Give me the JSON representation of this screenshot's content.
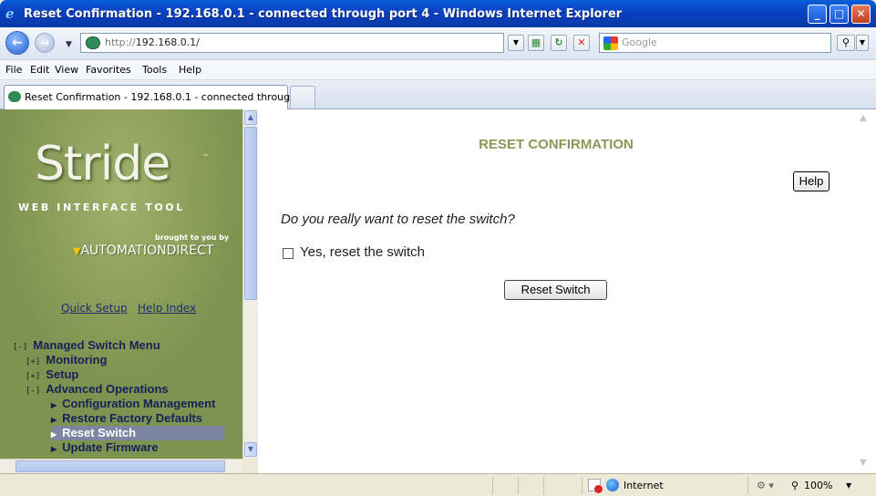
{
  "window": {
    "title": "Reset Confirmation - 192.168.0.1 - connected through port 4 - Windows Internet Explorer",
    "minimize": "_",
    "maximize": "□",
    "close": "✕"
  },
  "addressbar": {
    "url_prefix": "http://",
    "url_host": "192.168.0.1/",
    "search_placeholder": "Google"
  },
  "menubar": [
    "File",
    "Edit",
    "View",
    "Favorites",
    "Tools",
    "Help"
  ],
  "tab": {
    "label": "Reset Confirmation - 192.168.0.1 - connected throug..."
  },
  "sidebar": {
    "logo_word": "Stride",
    "logo_tm": "™",
    "tagline": "WEB INTERFACE TOOL",
    "brought_by": "brought to you by",
    "brand": "AUTOMATIONDIRECT",
    "links": {
      "quick_setup": "Quick Setup",
      "help_index": "Help Index"
    },
    "menu": {
      "root": {
        "toggle": "[-]",
        "label": "Managed Switch Menu"
      },
      "monitoring": {
        "toggle": "[+]",
        "label": "Monitoring"
      },
      "setup": {
        "toggle": "[+]",
        "label": "Setup"
      },
      "advanced": {
        "toggle": "[-]",
        "label": "Advanced Operations"
      },
      "items": [
        {
          "label": "Configuration Management",
          "selected": false
        },
        {
          "label": "Restore Factory Defaults",
          "selected": false
        },
        {
          "label": "Reset Switch",
          "selected": true
        },
        {
          "label": "Update Firmware",
          "selected": false
        }
      ]
    }
  },
  "main": {
    "title": "RESET CONFIRMATION",
    "help_label": "Help",
    "question": "Do you really want to reset the switch?",
    "checkbox_label": "Yes, reset the switch",
    "checkbox_checked": false,
    "reset_button": "Reset Switch"
  },
  "statusbar": {
    "zone": "Internet",
    "zoom": "100%"
  },
  "colors": {
    "title_accent": "#879a55",
    "sidebar_bg": "#7d9350",
    "menu_text": "#16215a",
    "selected_bg": "#7b86a3"
  }
}
